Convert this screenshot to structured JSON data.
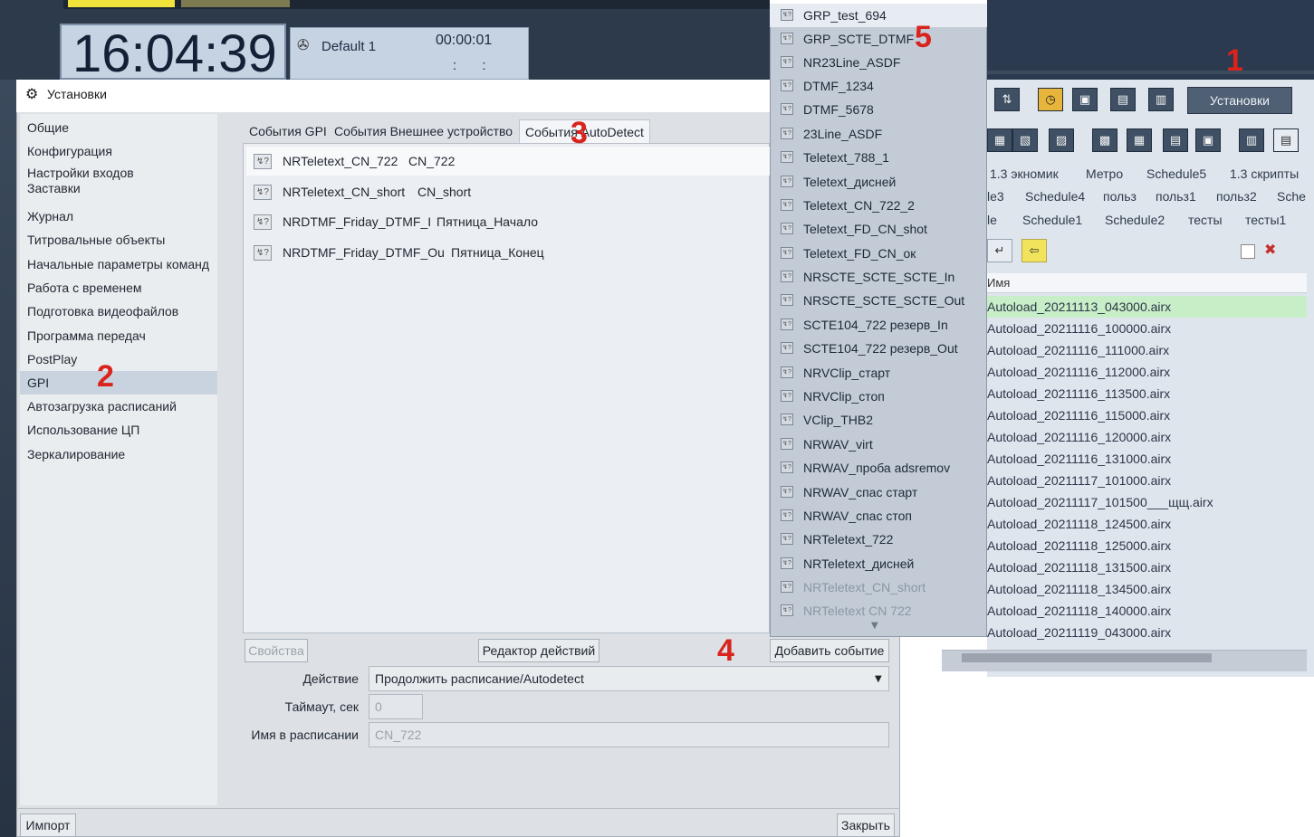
{
  "clock": {
    "time": "16:04:39"
  },
  "schedule": {
    "name": "Default 1",
    "timer": "00:00:01",
    "colon_display": ": :"
  },
  "dialog": {
    "title": "Установки",
    "nav_items": [
      "Общие",
      "Конфигурация",
      "Настройки входов\nЗаставки",
      "Журнал",
      "Титровальные объекты",
      "Начальные параметры команд",
      "Работа с временем",
      "Подготовка видеофайлов",
      "Программа передач",
      "PostPlay",
      "GPI",
      "Автозагрузка расписаний",
      "Использование ЦП",
      "Зеркалирование"
    ],
    "nav_selected": "GPI",
    "tabs": [
      "События GPI",
      "События Внешнее устройство",
      "События AutoDetect"
    ],
    "active_tab": "События AutoDetect",
    "events": [
      {
        "name": "NRTeletext_CN_722",
        "value": "CN_722"
      },
      {
        "name": "NRTeletext_CN_short",
        "value": "CN_short"
      },
      {
        "name": "NRDTMF_Friday_DTMF_I",
        "value": "Пятница_Начало"
      },
      {
        "name": "NRDTMF_Friday_DTMF_Ou",
        "value": "Пятница_Конец"
      }
    ],
    "buttons": {
      "properties": "Свойства",
      "action_editor": "Редактор действий",
      "add_event": "Добавить событие",
      "import": "Импорт",
      "close": "Закрыть"
    },
    "form": {
      "action_label": "Действие",
      "action_value": "Продолжить расписание/Autodetect",
      "timeout_label": "Таймаут, сек",
      "timeout_value": "0",
      "schedule_name_label": "Имя в расписании",
      "schedule_name_value": "CN_722"
    }
  },
  "dropdown": {
    "items": [
      "GRP_test_694",
      "GRP_SCTE_DTMF",
      "NR23Line_ASDF",
      "DTMF_1234",
      "DTMF_5678",
      "23Line_ASDF",
      "Teletext_788_1",
      "Teletext_дисней",
      "Teletext_CN_722_2",
      "Teletext_FD_CN_shot",
      "Teletext_FD_CN_ок",
      "NRSCTE_SCTE_SCTE_In",
      "NRSCTE_SCTE_SCTE_Out",
      "SCTE104_722 резерв_In",
      "SCTE104_722 резерв_Out",
      "NRVClip_старт",
      "NRVClip_стоп",
      "VClip_ТНВ2",
      "NRWAV_virt",
      "NRWAV_проба adsremov",
      "NRWAV_спас старт",
      "NRWAV_спас стоп",
      "NRTeletext_722",
      "NRTeletext_дисней",
      "NRTeletext_CN_short",
      "NRTeletext CN 722"
    ]
  },
  "right_app": {
    "settings_button": "Установки",
    "tab_rows": [
      [
        "1.3 экномик",
        "Метро",
        "Schedule5",
        "1.3 скрипты"
      ],
      [
        "le3",
        "Schedule4",
        "польз",
        "польз1",
        "польз2",
        "Sche"
      ],
      [
        "le",
        "Schedule1",
        "Schedule2",
        "тесты",
        "тесты1"
      ]
    ],
    "list_header": "Имя",
    "files": [
      "Autoload_20211113_043000.airx",
      "Autoload_20211116_100000.airx",
      "Autoload_20211116_111000.airx",
      "Autoload_20211116_112000.airx",
      "Autoload_20211116_113500.airx",
      "Autoload_20211116_115000.airx",
      "Autoload_20211116_120000.airx",
      "Autoload_20211116_131000.airx",
      "Autoload_20211117_101000.airx",
      "Autoload_20211117_101500___щщ.airx",
      "Autoload_20211118_124500.airx",
      "Autoload_20211118_125000.airx",
      "Autoload_20211118_131500.airx",
      "Autoload_20211118_134500.airx",
      "Autoload_20211118_140000.airx",
      "Autoload_20211119_043000.airx"
    ]
  },
  "annotations": [
    "1",
    "2",
    "3",
    "4",
    "5"
  ],
  "colors": {
    "annotation": "#d9231d",
    "selected_file": "#c8eec8"
  }
}
